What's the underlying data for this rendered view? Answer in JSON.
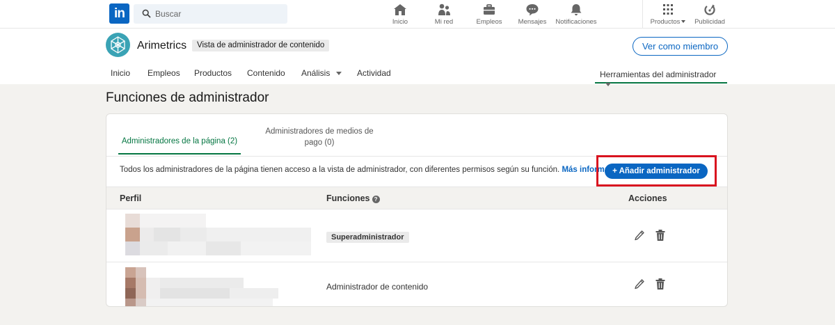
{
  "global_nav": {
    "logo_text": "in",
    "search_placeholder": "Buscar",
    "items": [
      {
        "label": "Inicio",
        "icon": "home-icon"
      },
      {
        "label": "Mi red",
        "icon": "network-icon"
      },
      {
        "label": "Empleos",
        "icon": "briefcase-icon"
      },
      {
        "label": "Mensajes",
        "icon": "messages-icon"
      },
      {
        "label": "Notificaciones",
        "icon": "bell-icon"
      }
    ],
    "products_label": "Productos",
    "ads_label": "Publicidad"
  },
  "company": {
    "name": "Arimetrics",
    "view_badge": "Vista de administrador de contenido",
    "member_view_button": "Ver como miembro"
  },
  "subnav": {
    "items": [
      "Inicio",
      "Empleos",
      "Productos",
      "Contenido",
      "Análisis",
      "Actividad"
    ],
    "admin_tools": "Herramientas del administrador"
  },
  "page": {
    "title": "Funciones de administrador"
  },
  "tabs": {
    "page_admins": "Administradores de la página (2)",
    "paid_admins_line1": "Administradores de medios de",
    "paid_admins_line2": "pago (0)"
  },
  "info": {
    "text": "Todos los administradores de la página tienen acceso a la vista de administrador, con diferentes permisos según su función.",
    "more_link": "Más información",
    "add_button": "Añadir administrador"
  },
  "table": {
    "headers": {
      "profile": "Perfil",
      "roles": "Funciones",
      "actions": "Acciones"
    },
    "rows": [
      {
        "role": "Superadministrador"
      },
      {
        "role": "Administrador de contenido"
      }
    ]
  },
  "colors": {
    "brand": "#0a66c2",
    "active_tab": "#057642",
    "highlight_box": "#d9131f",
    "page_bg": "#f3f2ef"
  }
}
